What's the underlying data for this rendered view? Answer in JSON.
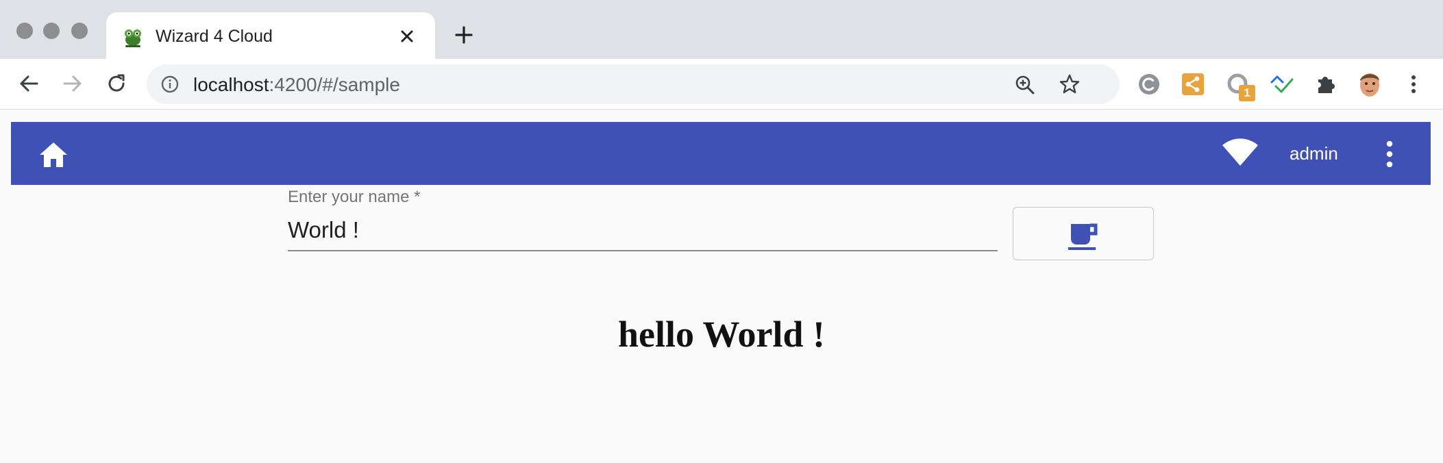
{
  "browser": {
    "tab": {
      "title": "Wizard 4 Cloud"
    },
    "address": {
      "host": "localhost",
      "path": ":4200/#/sample"
    }
  },
  "extensions": {
    "badge_count": "1"
  },
  "app": {
    "user": "admin",
    "form": {
      "label": "Enter your name *",
      "value": "World !"
    },
    "greeting": {
      "prefix": "hello",
      "name": "World !"
    }
  },
  "colors": {
    "primary": "#3f51b5",
    "background": "#fafafa",
    "tabstrip": "#dee1e6"
  }
}
